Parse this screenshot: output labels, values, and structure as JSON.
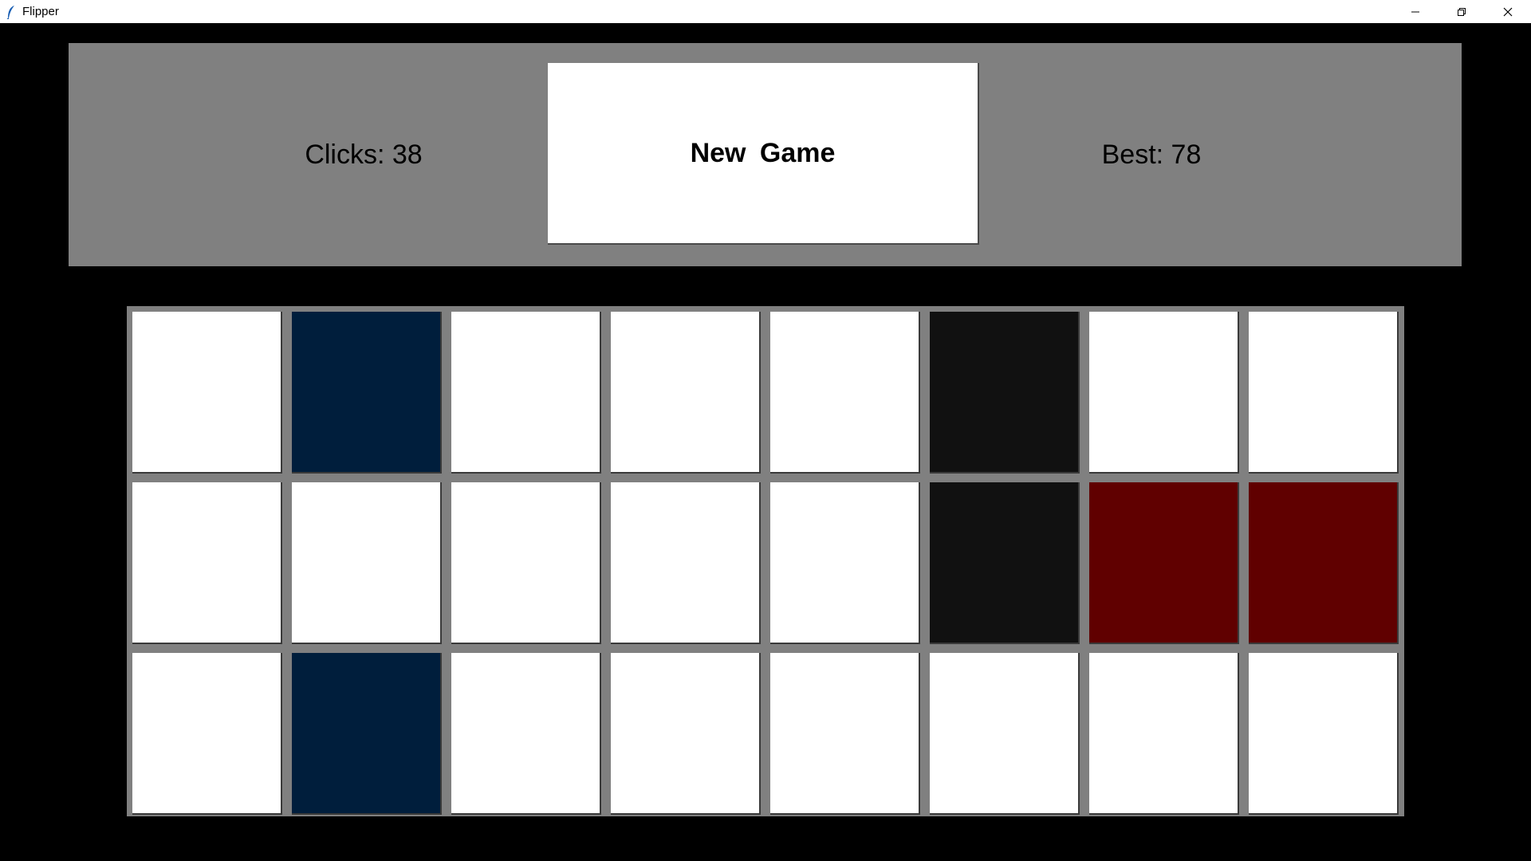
{
  "window": {
    "title": "Flipper",
    "icon": "feather-icon",
    "controls": [
      "minimize-icon",
      "restore-icon",
      "close-icon"
    ]
  },
  "header": {
    "clicks_label": "Clicks: 38",
    "new_game_label": "New  Game",
    "best_label": "Best: 78",
    "panel_color": "#808080"
  },
  "colors": {
    "white": "#ffffff",
    "navy": "#001e3c",
    "black": "#111111",
    "maroon": "#600000",
    "board_border": "#808080",
    "background": "#000000"
  },
  "board": {
    "rows": 3,
    "cols": 8,
    "tiles": [
      [
        "white",
        "navy",
        "white",
        "white",
        "white",
        "black",
        "white",
        "white"
      ],
      [
        "white",
        "white",
        "white",
        "white",
        "white",
        "black",
        "maroon",
        "maroon"
      ],
      [
        "white",
        "navy",
        "white",
        "white",
        "white",
        "white",
        "white",
        "white"
      ]
    ]
  }
}
